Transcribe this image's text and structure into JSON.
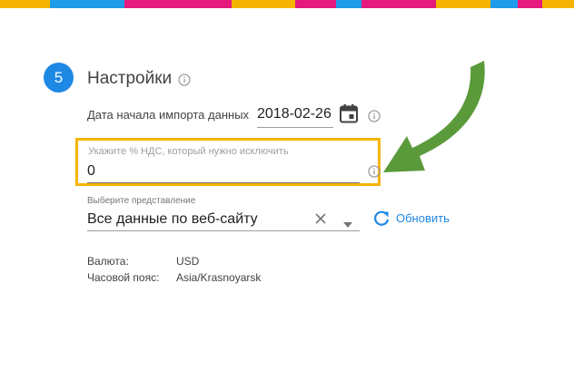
{
  "strip_colors": [
    "#f4b400",
    "#1e9be9",
    "#e6197d",
    "#f4b400",
    "#e6197d",
    "#1e9be9",
    "#e6197d",
    "#f4b400",
    "#1e9be9",
    "#e6197d",
    "#f4b400"
  ],
  "step": {
    "number": "5",
    "title": "Настройки",
    "accent_color": "#1e88e5"
  },
  "date_import": {
    "label": "Дата начала импорта данных",
    "value": "2018-02-26"
  },
  "vat": {
    "label": "Укажите % НДС, который нужно исключить",
    "value": "0",
    "highlight_color": "#f4b400"
  },
  "view": {
    "label": "Выберите представление",
    "selected": "Все данные по веб-сайту"
  },
  "refresh": {
    "label": "Обновить"
  },
  "meta": {
    "currency_label": "Валюта:",
    "currency_value": "USD",
    "timezone_label": "Часовой пояс:",
    "timezone_value": "Asia/Krasnoyarsk"
  },
  "icons": {
    "title_info": "info-icon",
    "date_info": "info-icon",
    "vat_info": "info-icon",
    "calendar": "calendar-icon",
    "clear": "close-icon",
    "dropdown": "chevron-down-icon",
    "refresh": "refresh-icon",
    "arrow": "arrow-annotation-icon"
  },
  "arrow_color": "#5b9a3a"
}
